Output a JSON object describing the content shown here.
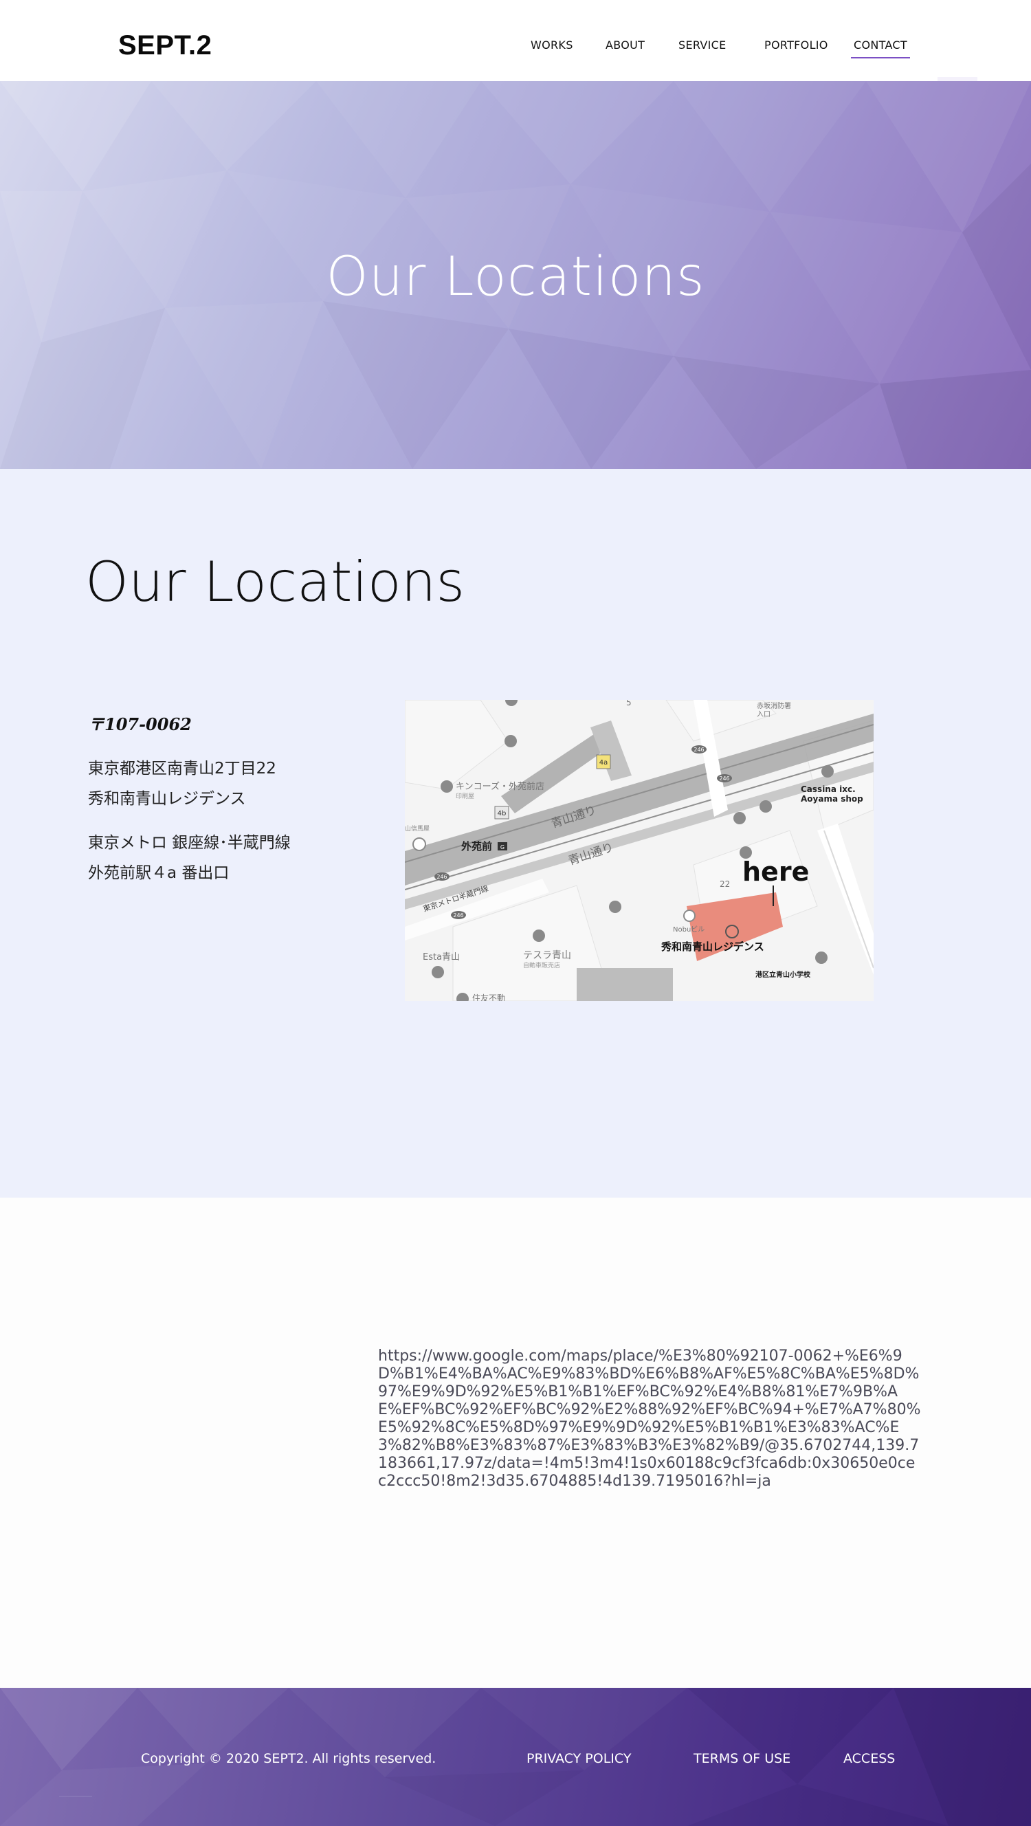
{
  "header": {
    "logo": "SEPT.2",
    "nav": [
      "WORKS",
      "ABOUT",
      "SERVICE",
      "PORTFOLIO",
      "CONTACT"
    ],
    "active": "CONTACT",
    "accent_color": "#7b4fc4"
  },
  "hero": {
    "title": "Our Locations",
    "gradient_colors": [
      "#d7d9ee",
      "#b8b9e0",
      "#a59ed4",
      "#8c6fbd"
    ]
  },
  "locations": {
    "title": "Our Locations",
    "postal": "〒107-0062",
    "address_lines": [
      "東京都港区南青山2丁目22",
      "秀和南青山レジデンス"
    ],
    "station_lines": [
      "東京メトロ 銀座線･半蔵門線",
      "外苑前駅４a 番出口"
    ],
    "background": "#edf0fc"
  },
  "map": {
    "marker_label": "here",
    "building_label": "秀和南青山レジデンス",
    "labels": {
      "station": "外苑前",
      "station_badge": "G",
      "street_1": "青山通り",
      "street_2": "青山通り",
      "metro_line": "東京メトロ半蔵門線",
      "shop": "キンコーズ・外苑前店",
      "shop_sub": "印刷屋",
      "cassina_1": "Cassina ixc.",
      "cassina_2": "Aoyama shop",
      "tesla": "テスラ青山",
      "tesla_sub": "自動車販売店",
      "esta": "Esta青山",
      "nobu": "Nobuビル",
      "school": "港区立青山小学校",
      "fire": "赤坂消防署",
      "fire_2": "入口",
      "sumitomo": "住友不動",
      "exit_4a": "4a",
      "exit_4b": "4b",
      "route_246_a": "246",
      "route_246_b": "246",
      "route_246_c": "246",
      "route_246_d": "246",
      "block_22": "22",
      "block_5": "5",
      "left_edge": "山信馬屋"
    },
    "highlight_color": "#e98c7d"
  },
  "link": {
    "url": "https://www.google.com/maps/place/%E3%80%92107-0062+%E6%9D%B1%E4%BA%AC%E9%83%BD%E6%B8%AF%E5%8C%BA%E5%8D%97%E9%9D%92%E5%B1%B1%EF%BC%92%E4%B8%81%E7%9B%AE%EF%BC%92%EF%BC%92%E2%88%92%EF%BC%94+%E7%A7%80%E5%92%8C%E5%8D%97%E9%9D%92%E5%B1%B1%E3%83%AC%E3%82%B8%E3%83%87%E3%83%B3%E3%82%B9/@35.6702744,139.7183661,17.97z/data=!4m5!3m4!1s0x60188c9cf3fca6db:0x30650e0cec2ccc50!8m2!3d35.6704885!4d139.7195016?hl=ja"
  },
  "footer": {
    "copyright": "Copyright © 2020 SEPT2. All rights reserved.",
    "links": [
      "PRIVACY POLICY",
      "TERMS OF USE",
      "ACCESS"
    ]
  }
}
